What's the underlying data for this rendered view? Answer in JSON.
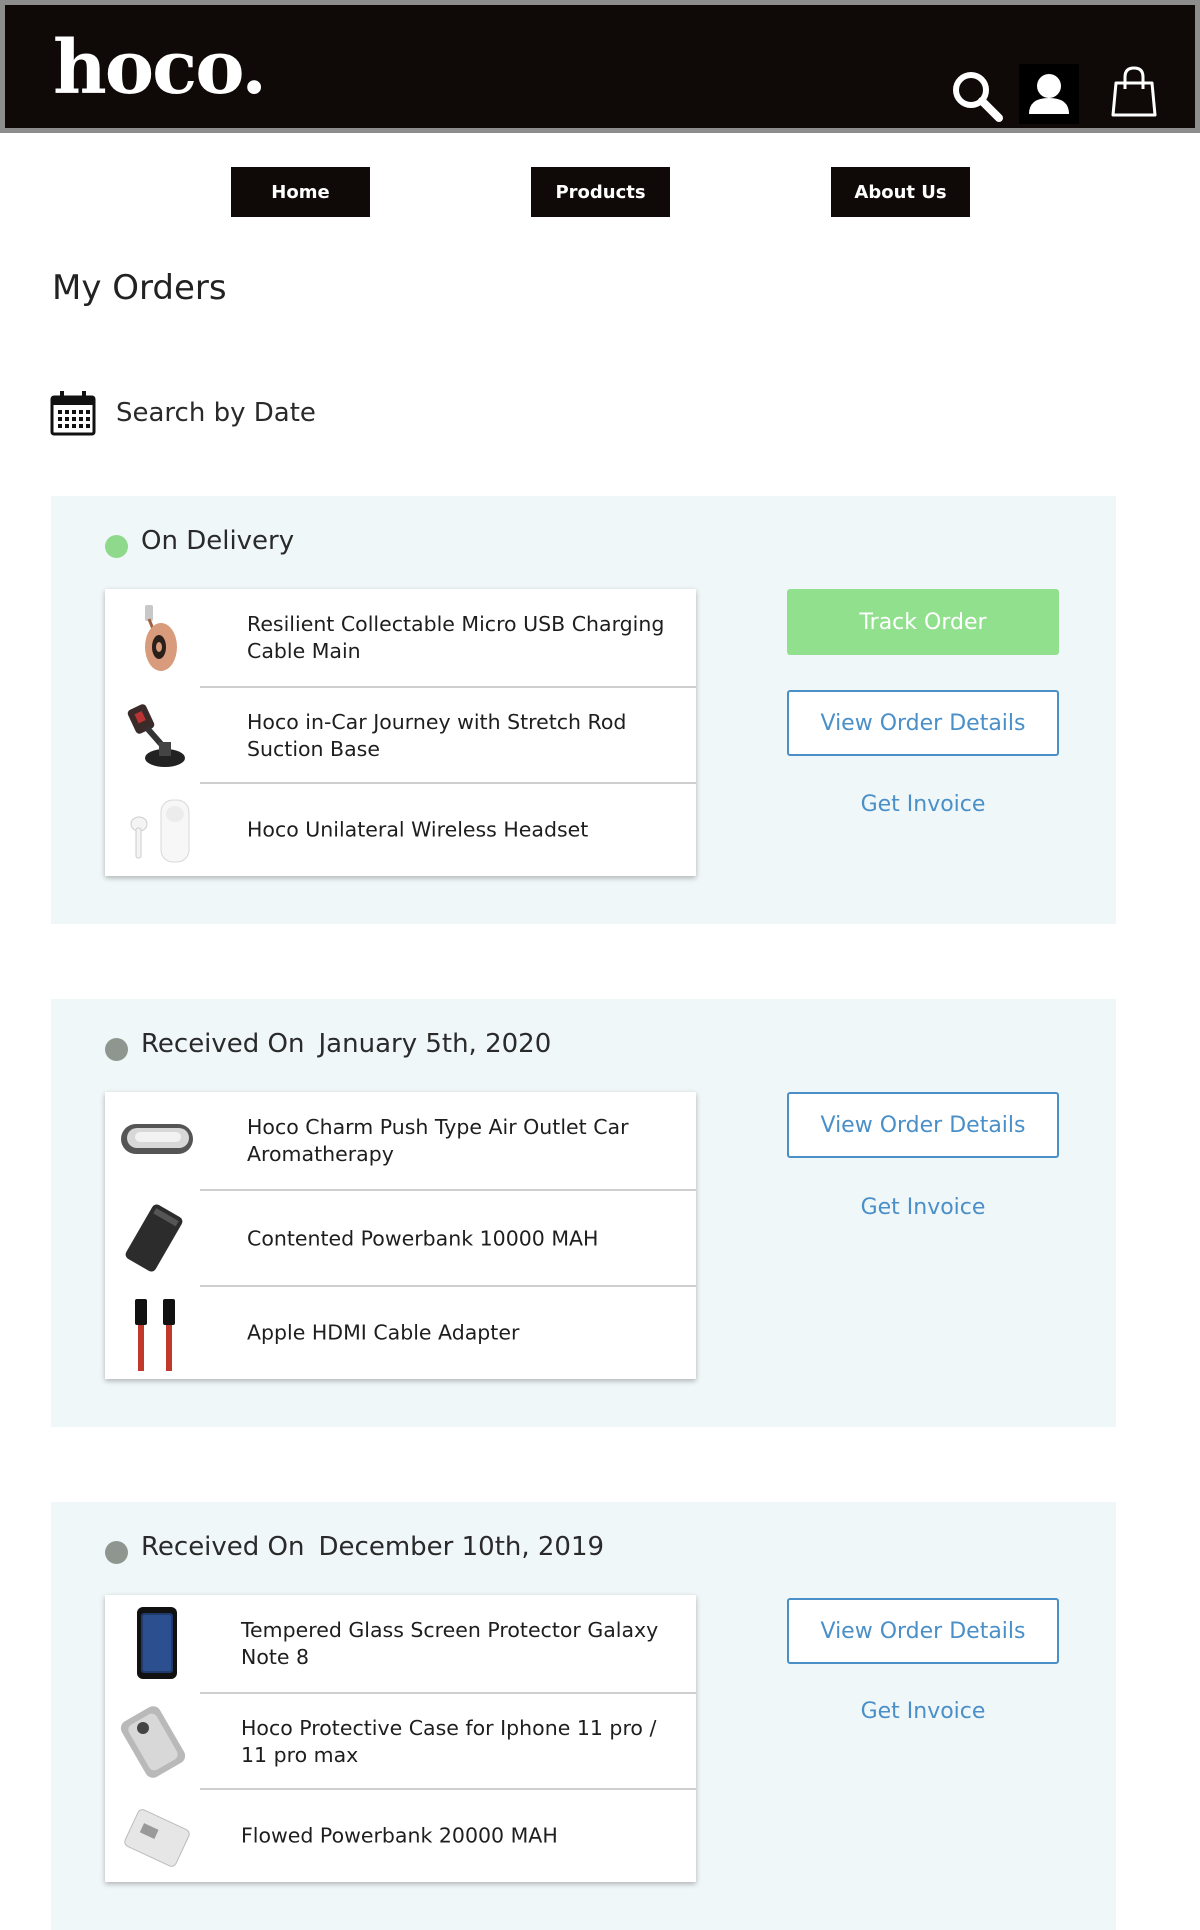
{
  "header": {
    "logo": "hoco.",
    "icons": [
      "search-icon",
      "user-icon",
      "shopping-bag-icon"
    ]
  },
  "nav": {
    "home": "Home",
    "products": "Products",
    "about": "About Us"
  },
  "page_title": "My Orders",
  "search": {
    "label": "Search by Date",
    "icon": "calendar-icon"
  },
  "actions": {
    "track_order": "Track Order",
    "view_details": "View Order Details",
    "get_invoice": "Get Invoice"
  },
  "colors": {
    "header_bg": "#0f0a08",
    "card_bg": "#f0f7f9",
    "status_active": "#8ed98b",
    "status_done": "#8f9690",
    "track_button": "#91e08e",
    "link_blue": "#4a8fc8"
  },
  "orders": [
    {
      "status": "On Delivery",
      "date": "",
      "items": [
        {
          "name": "Resilient Collectable Micro USB Charging Cable Main",
          "thumb": "usb-cable-reel"
        },
        {
          "name": "Hoco in-Car Journey with Stretch Rod Suction Base",
          "thumb": "car-phone-mount"
        },
        {
          "name": "Hoco Unilateral Wireless Headset",
          "thumb": "wireless-earbud"
        }
      ]
    },
    {
      "status": "Received On",
      "date": "January 5th, 2020",
      "items": [
        {
          "name": "Hoco Charm Push Type Air Outlet Car Aromatherapy",
          "thumb": "car-aroma-clip"
        },
        {
          "name": "Contented Powerbank 10000 MAH",
          "thumb": "powerbank-black"
        },
        {
          "name": "Apple HDMI Cable Adapter",
          "thumb": "hdmi-cable"
        }
      ]
    },
    {
      "status": "Received On",
      "date": "December 10th, 2019",
      "items": [
        {
          "name": "Tempered Glass Screen Protector Galaxy Note 8",
          "thumb": "screen-protector"
        },
        {
          "name": "Hoco Protective Case for Iphone 11 pro / 11 pro max",
          "thumb": "phone-case"
        },
        {
          "name": "Flowed Powerbank 20000 MAH",
          "thumb": "powerbank-white"
        }
      ]
    }
  ]
}
